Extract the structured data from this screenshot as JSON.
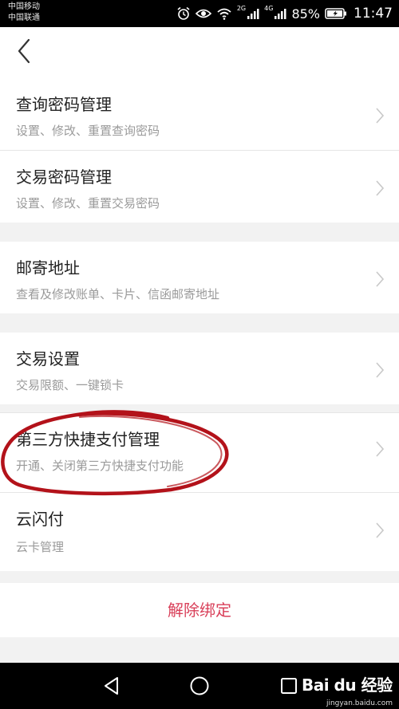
{
  "status_bar": {
    "carrier_1": "中国移动",
    "carrier_2": "中国联通",
    "signal_1_label": "2G",
    "signal_2_label": "4G",
    "battery": "85%",
    "time": "11:47",
    "icons": [
      "alarm-icon",
      "eye-icon",
      "wifi-icon",
      "signal-icon",
      "signal-icon",
      "battery-icon"
    ]
  },
  "header": {
    "back_icon": "chevron-left-icon"
  },
  "items": [
    {
      "title": "查询密码管理",
      "subtitle": "设置、修改、重置查询密码"
    },
    {
      "title": "交易密码管理",
      "subtitle": "设置、修改、重置交易密码"
    },
    {
      "title": "邮寄地址",
      "subtitle": "查看及修改账单、卡片、信函邮寄地址"
    },
    {
      "title": "交易设置",
      "subtitle": "交易限额、一键锁卡"
    },
    {
      "title": "第三方快捷支付管理",
      "subtitle": "开通、关闭第三方快捷支付功能"
    },
    {
      "title": "云闪付",
      "subtitle": "云卡管理"
    }
  ],
  "unbind_label": "解除绑定",
  "colors": {
    "accent": "#d9405a",
    "annotation": "#b3121a",
    "background": "#f2f2f2",
    "subtitle": "#9a9a9a"
  },
  "nav_bar": {
    "icons": [
      "back-triangle-icon",
      "home-circle-icon",
      "recents-square-icon"
    ]
  },
  "watermark": {
    "brand": "Bai du 经验",
    "url": "jingyan.baidu.com"
  }
}
